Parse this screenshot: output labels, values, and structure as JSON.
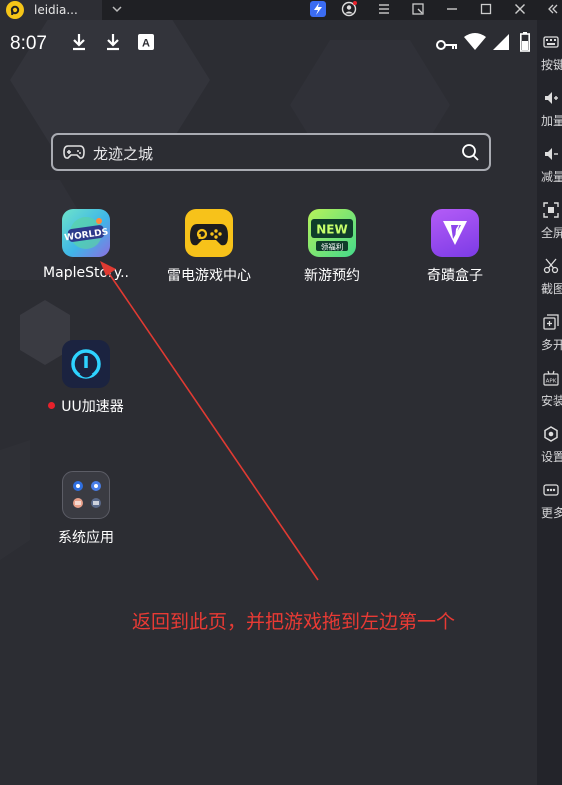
{
  "titlebar": {
    "tab_title": "leidia...",
    "controls": [
      "lightning-badge",
      "account-icon",
      "menu-icon",
      "popout-icon",
      "minimize-icon",
      "maximize-icon",
      "close-icon"
    ]
  },
  "statusbar": {
    "time": "8:07",
    "notification_icons": [
      "download-icon",
      "download-icon",
      "text-icon"
    ],
    "system_icons": [
      "key-icon",
      "wifi-icon",
      "signal-icon",
      "battery-icon"
    ]
  },
  "search": {
    "text": "龙迹之城",
    "left_icon": "gamepad-icon",
    "right_icon": "search-icon"
  },
  "apps": [
    {
      "label": "MapleStory..",
      "icon": "maplestory-worlds-icon",
      "badge_text": "WORLDS"
    },
    {
      "label": "雷电游戏中心",
      "icon": "leidian-gamecenter-icon"
    },
    {
      "label": "新游预约",
      "icon": "new-games-icon",
      "badge_text": "NEW",
      "sub_badge": "领福利"
    },
    {
      "label": "奇蹟盒子",
      "icon": "qiji-box-icon"
    },
    {
      "label": "UU加速器",
      "icon": "uu-accelerator-icon",
      "has_red_dot": true
    },
    {
      "label": "系统应用",
      "icon": "system-apps-folder-icon"
    }
  ],
  "annotation": {
    "text": "返回到此页，并把游戏拖到左边第一个",
    "color": "#e83a34"
  },
  "sidebar": {
    "items": [
      {
        "label": "按键",
        "icon": "keyboard-icon"
      },
      {
        "label": "加量",
        "icon": "volume-up-icon"
      },
      {
        "label": "减量",
        "icon": "volume-down-icon"
      },
      {
        "label": "全屏",
        "icon": "fullscreen-icon"
      },
      {
        "label": "截图",
        "icon": "scissors-icon"
      },
      {
        "label": "多开",
        "icon": "multi-instance-icon"
      },
      {
        "label": "安装",
        "icon": "apk-install-icon"
      },
      {
        "label": "设置",
        "icon": "settings-icon"
      },
      {
        "label": "更多",
        "icon": "more-icon"
      }
    ]
  },
  "colors": {
    "screen_bg": "#2c2d33",
    "accent_red": "#e8212b",
    "sidebar_bg": "#23242a"
  }
}
